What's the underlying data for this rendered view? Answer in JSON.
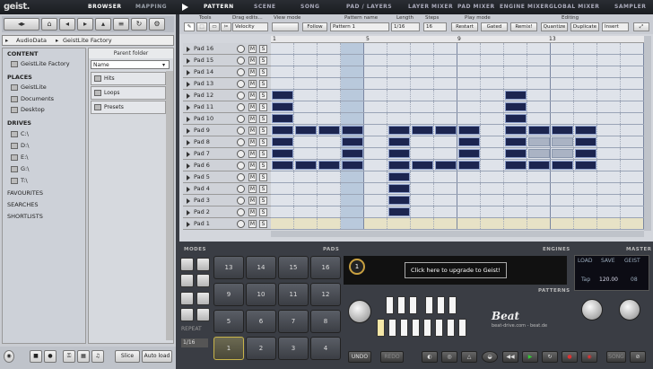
{
  "app": {
    "logo": "geist."
  },
  "left_tabs": [
    "BROWSER",
    "MAPPING"
  ],
  "right_tabs": [
    "PATTERN",
    "SCENE",
    "SONG",
    "PAD / LAYERS",
    "LAYER MIXER",
    "PAD MIXER",
    "ENGINE MIXER",
    "GLOBAL MIXER",
    "SAMPLER"
  ],
  "breadcrumb": [
    "AudioData",
    "GeistLite Factory"
  ],
  "browser": {
    "content_header": "CONTENT",
    "content_items": [
      "GeistLite Factory"
    ],
    "places_header": "PLACES",
    "places_items": [
      "GeistLite",
      "Documents",
      "Desktop"
    ],
    "drives_header": "DRIVES",
    "drives_items": [
      "C:\\",
      "D:\\",
      "E:\\",
      "G:\\",
      "T:\\"
    ],
    "extra": [
      "FAVOURITES",
      "SEARCHES",
      "SHORTLISTS"
    ],
    "parent_folder": "Parent folder",
    "sort_by": "Name",
    "folders": [
      "Hits",
      "Loops",
      "Presets"
    ],
    "slice_label": "Slice",
    "autoload_label": "Auto load"
  },
  "pattern_toolbar": {
    "tools_label": "Tools",
    "drag_label": "Drag edits...",
    "drag_value": "Velocity",
    "view_label": "View mode",
    "follow_label": "Follow",
    "pattern_name_label": "Pattern name",
    "pattern_name": "Pattern 1",
    "length_label": "Length",
    "length_value": "1/16",
    "steps_label": "Steps",
    "steps_value": "16",
    "play_label": "Play mode",
    "restart_label": "Restart",
    "gated_label": "Gated",
    "remix_label": "Remix!",
    "editing_label": "Editing",
    "quantize_label": "Quantize",
    "duplicate_label": "Duplicate",
    "insert_label": "Insert"
  },
  "ruler": [
    "1",
    "5",
    "9",
    "13"
  ],
  "pads": [
    "Pad 16",
    "Pad 15",
    "Pad 14",
    "Pad 13",
    "Pad 12",
    "Pad 11",
    "Pad 10",
    "Pad 9",
    "Pad 8",
    "Pad 7",
    "Pad 6",
    "Pad 5",
    "Pad 4",
    "Pad 3",
    "Pad 2",
    "Pad 1"
  ],
  "mute_label": "M",
  "solo_label": "S",
  "bottom": {
    "modes_header": "MODES",
    "pads_header": "PADS",
    "engines_header": "ENGINES",
    "master_header": "MASTER",
    "patterns_header": "PATTERNS",
    "pad_numbers": [
      "13",
      "14",
      "15",
      "16",
      "9",
      "10",
      "11",
      "12",
      "5",
      "6",
      "7",
      "8",
      "1",
      "2",
      "3",
      "4"
    ],
    "engine_number": "1",
    "upgrade_text": "Click here to upgrade to Geist!",
    "master_load": "LOAD",
    "master_save": "SAVE",
    "master_geist": "GEIST",
    "tap_label": "Tap",
    "tempo": "120.00",
    "tempo_sub": "08",
    "repeat_label": "REPEAT",
    "repeat_value": "1/16",
    "undo_label": "UNDO",
    "redo_label": "REDO",
    "song_label": "SONG",
    "brand": "Beat",
    "brand_url": "beat-drive.com - beat.de"
  }
}
